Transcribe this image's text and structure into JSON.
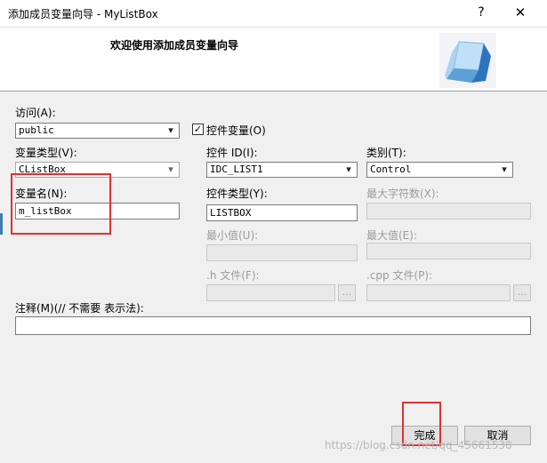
{
  "window": {
    "title": "添加成员变量向导 - MyListBox",
    "help": "?",
    "close": "✕"
  },
  "header": {
    "title": "欢迎使用添加成员变量向导",
    "icon": "cube-icon"
  },
  "form": {
    "access_label": "访问(A):",
    "access_value": "public",
    "control_var_checked": true,
    "control_var_label": "控件变量(O)",
    "var_type_label": "变量类型(V):",
    "var_type_value": "CListBox",
    "control_id_label": "控件 ID(I):",
    "control_id_value": "IDC_LIST1",
    "category_label": "类别(T):",
    "category_value": "Control",
    "var_name_label": "变量名(N):",
    "var_name_value": "m_listBox",
    "control_type_label": "控件类型(Y):",
    "control_type_value": "LISTBOX",
    "max_chars_label": "最大字符数(X):",
    "min_label": "最小值(U):",
    "max_label": "最大值(E):",
    "h_file_label": ".h 文件(F):",
    "cpp_file_label": ".cpp 文件(P):",
    "browse_label": "...",
    "comment_label": "注释(M)(// 不需要 表示法):",
    "comment_value": ""
  },
  "buttons": {
    "finish": "完成",
    "cancel": "取消"
  },
  "watermark": "https://blog.csdn.net/qq_45661538",
  "colors": {
    "annotation_red": "#e0312f"
  }
}
